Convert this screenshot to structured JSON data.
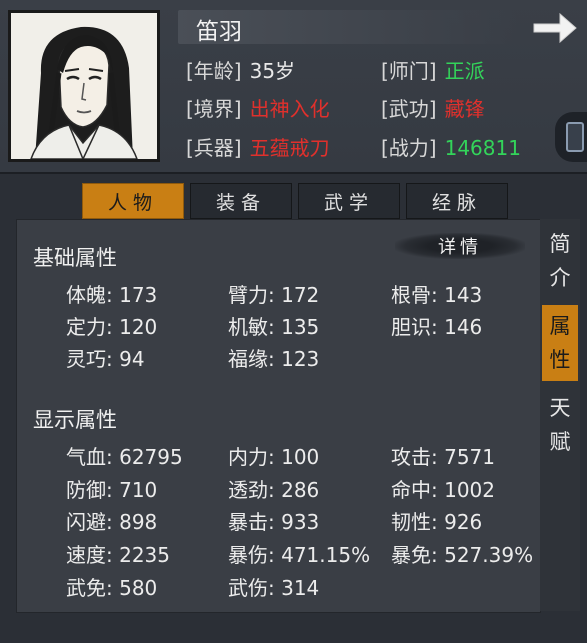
{
  "header": {
    "name": "笛羽",
    "rows": [
      {
        "label": "[年龄]",
        "value": "35岁",
        "color": "#e9e9e9"
      },
      {
        "label": "[师门]",
        "value": "正派",
        "color": "#33d45a"
      },
      {
        "label": "[境界]",
        "value": "出神入化",
        "color": "#e0302c"
      },
      {
        "label": "[武功]",
        "value": "藏锋",
        "color": "#e0302c"
      },
      {
        "label": "[兵器]",
        "value": "五蕴戒刀",
        "color": "#e0302c"
      },
      {
        "label": "[战力]",
        "value": "146811",
        "color": "#33d45a"
      }
    ]
  },
  "tabs": [
    "人物",
    "装备",
    "武学",
    "经脉"
  ],
  "active_tab": "人物",
  "side_tabs": [
    {
      "chars": [
        "简",
        "介"
      ],
      "active": false
    },
    {
      "chars": [
        "属",
        "性"
      ],
      "active": true
    },
    {
      "chars": [
        "天",
        "赋"
      ],
      "active": false
    }
  ],
  "details_label": "详情",
  "basic": {
    "title": "基础属性",
    "stats": [
      "体魄: 173",
      "臂力: 172",
      "根骨: 143",
      "定力: 120",
      "机敏: 135",
      "胆识: 146",
      "灵巧: 94",
      "福缘: 123"
    ]
  },
  "display": {
    "title": "显示属性",
    "stats": [
      "气血: 62795",
      "内力: 100",
      "攻击: 7571",
      "防御: 710",
      "透劲: 286",
      "命中: 1002",
      "闪避: 898",
      "暴击: 933",
      "韧性: 926",
      "速度: 2235",
      "暴伤: 471.15%",
      "暴免: 527.39%",
      "武免: 580",
      "武伤: 314"
    ]
  }
}
